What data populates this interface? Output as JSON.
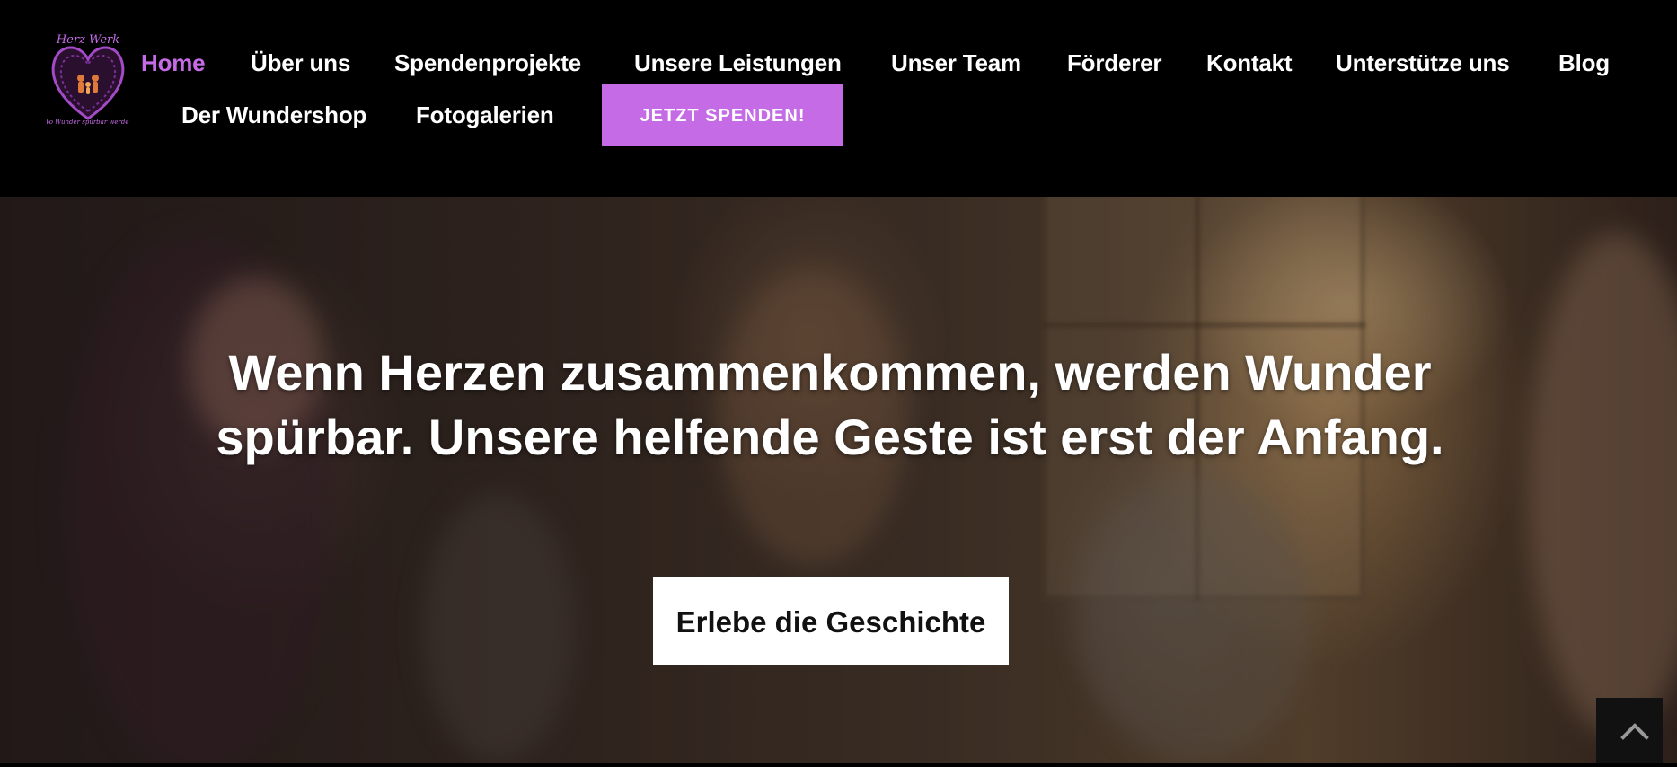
{
  "brand": {
    "logo_icon": "heart-family-logo-icon",
    "logo_text_top": "Herz Werk",
    "logo_text_bottom": "Wo Wunder spürbar werden"
  },
  "nav": {
    "items": [
      {
        "label": "Home",
        "active": true
      },
      {
        "label": "Über uns"
      },
      {
        "label": "Spendenprojekte"
      },
      {
        "label": "Unsere Leistungen"
      },
      {
        "label": "Unser Team"
      },
      {
        "label": "Förderer"
      },
      {
        "label": "Kontakt"
      },
      {
        "label": "Unterstütze uns"
      },
      {
        "label": "Blog"
      },
      {
        "label": "Der Wundershop"
      },
      {
        "label": "Fotogalerien"
      }
    ],
    "donate_label": "JETZT SPENDEN!"
  },
  "hero": {
    "title": "Wenn Herzen zusammenkommen, werden Wunder spürbar. Unsere helfende Geste ist erst der Anfang.",
    "cta_label": "Erlebe die Geschichte"
  },
  "scroll_top": {
    "icon": "chevron-up-icon"
  },
  "colors": {
    "accent": "#c56be6",
    "header_bg": "#000000",
    "cta_bg": "#ffffff"
  }
}
